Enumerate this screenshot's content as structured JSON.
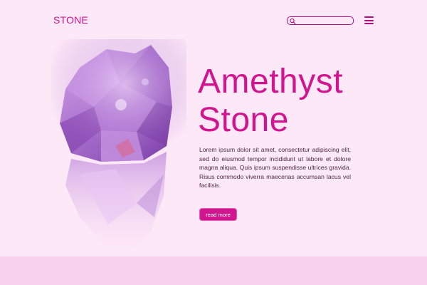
{
  "header": {
    "logo": "STONE",
    "search": {
      "value": "",
      "placeholder": ""
    }
  },
  "hero": {
    "title_line1": "Amethyst",
    "title_line2": "Stone",
    "description": "Lorem ipsum dolor sit amet, consectetur adipiscing elit, sed do eiusmod tempor incididunt ut labore et dolore magna aliqua. Quis ipsum suspendisse ultrices gravida. Risus commodo viverra maecenas accumsan lacus vel facilisis.",
    "cta_label": "read more"
  },
  "colors": {
    "background": "#fde8f7",
    "accent": "#d0158e",
    "footer_band": "#f9d3ee"
  },
  "icons": {
    "search": "search-icon",
    "menu": "hamburger-menu-icon"
  }
}
